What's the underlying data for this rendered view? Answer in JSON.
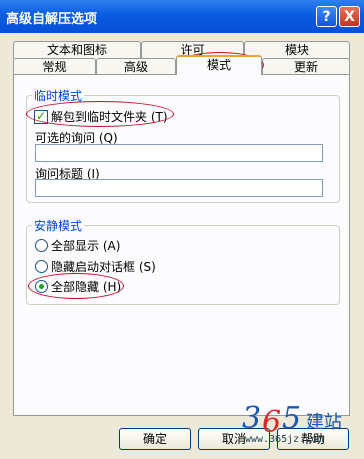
{
  "window": {
    "title": "高级自解压选项"
  },
  "title_buttons": {
    "help": "?",
    "close": "X"
  },
  "tabs_row1": [
    "文本和图标",
    "许可",
    "模块"
  ],
  "tabs_row2": [
    "常规",
    "高级",
    "模式",
    "更新"
  ],
  "active_tab": "模式",
  "temp_mode": {
    "group_label": "临时模式",
    "checkbox_label": "解包到临时文件夹 (T)",
    "checkbox_checked": true,
    "optional_question_label": "可选的询问 (Q)",
    "optional_question_value": "",
    "question_title_label": "询问标题 (I)",
    "question_title_value": ""
  },
  "silent_mode": {
    "group_label": "安静模式",
    "options": [
      "全部显示 (A)",
      "隐藏启动对话框 (S)",
      "全部隐藏 (H)"
    ],
    "selected_index": 2
  },
  "buttons": {
    "ok": "确定",
    "cancel": "取消",
    "help": "帮助"
  },
  "watermark": {
    "logo": "365建站",
    "url": "www.365jz.com"
  },
  "colors": {
    "title_bar": "#0a5ce0",
    "group_label": "#0046d5",
    "highlight_ellipse": "#c8102e"
  }
}
